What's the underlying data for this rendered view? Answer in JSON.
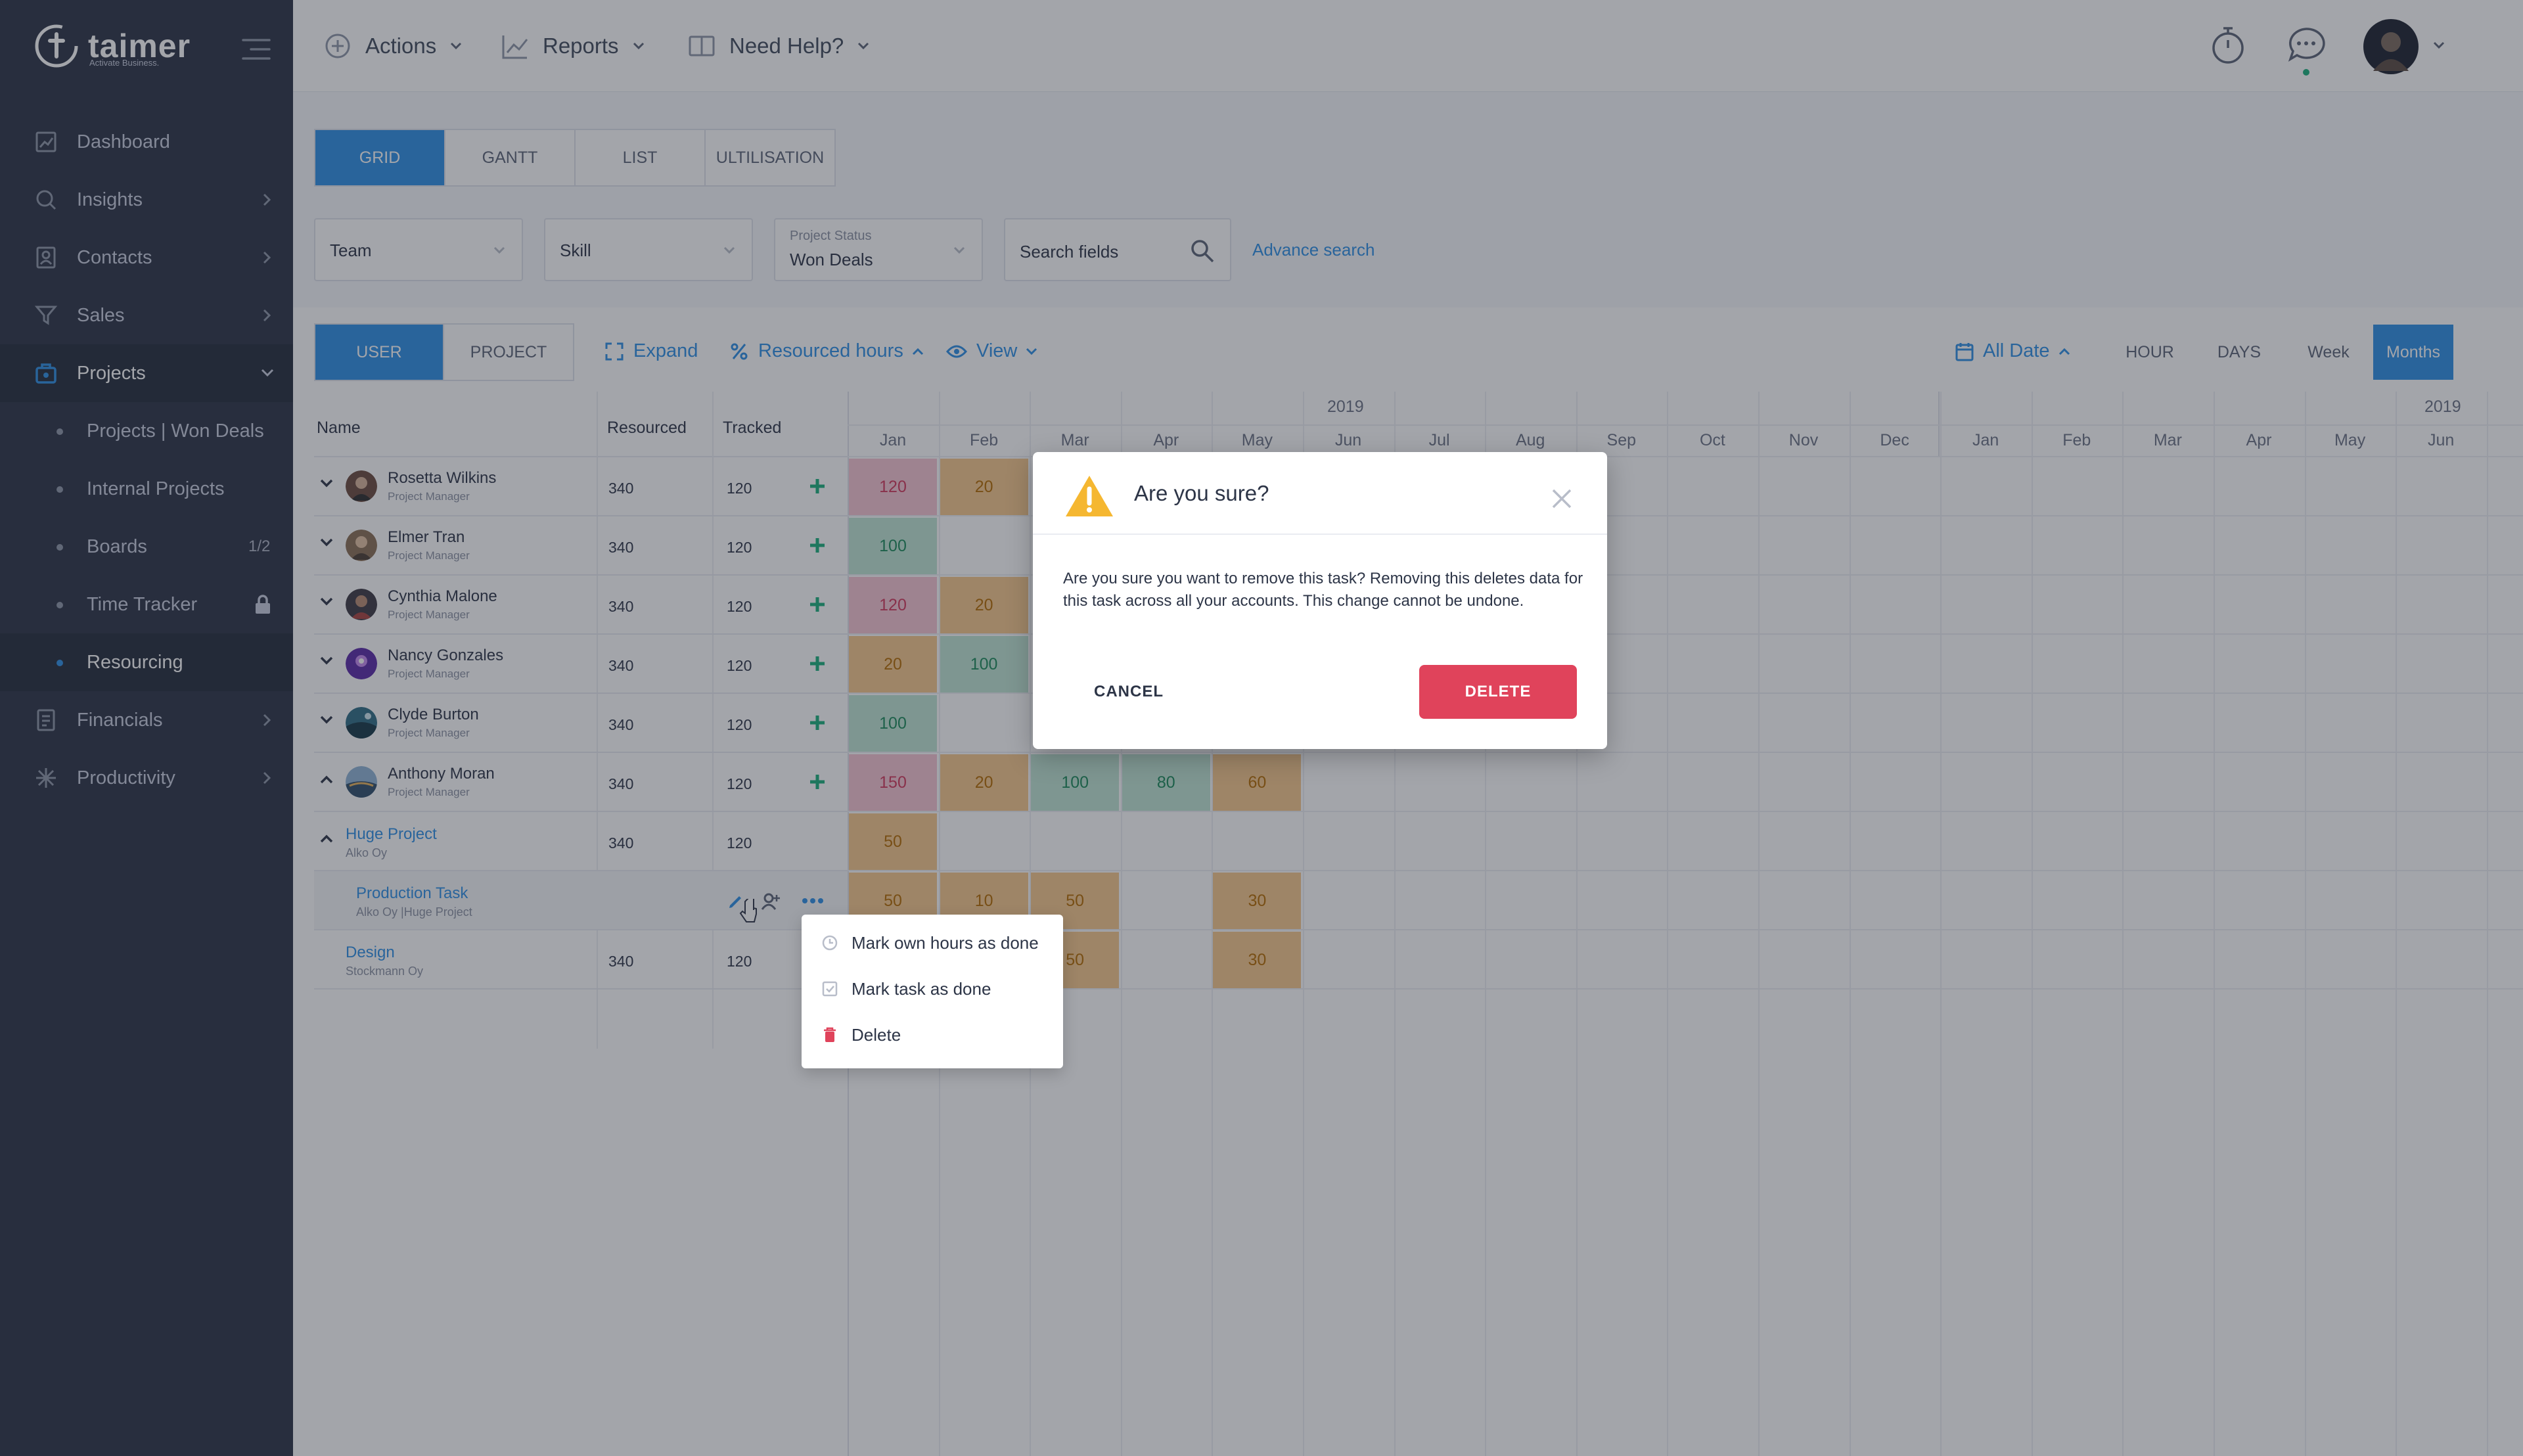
{
  "app": {
    "brand": "taimer",
    "tagline": "Activate Business."
  },
  "sidebar": {
    "items": [
      {
        "label": "Dashboard",
        "icon": "dashboard-icon"
      },
      {
        "label": "Insights",
        "icon": "insights-icon"
      },
      {
        "label": "Contacts",
        "icon": "contacts-icon"
      },
      {
        "label": "Sales",
        "icon": "filter-icon"
      },
      {
        "label": "Projects",
        "icon": "briefcase-icon"
      },
      {
        "label": "Financials",
        "icon": "financials-icon"
      },
      {
        "label": "Productivity",
        "icon": "productivity-icon"
      }
    ],
    "sub_items": [
      {
        "label": "Projects | Won Deals"
      },
      {
        "label": "Internal Projects"
      },
      {
        "label": "Boards",
        "count": "1/2"
      },
      {
        "label": "Time Tracker",
        "locked": true
      },
      {
        "label": "Resourcing"
      }
    ]
  },
  "header": {
    "actions": "Actions",
    "reports": "Reports",
    "help": "Need Help?"
  },
  "view_tabs": [
    "GRID",
    "GANTT",
    "LIST",
    "ULTILISATION"
  ],
  "filters": {
    "team": "Team",
    "skill": "Skill",
    "project_status_label": "Project Status",
    "project_status_value": "Won Deals",
    "search_placeholder": "Search fields",
    "advance_search": "Advance search"
  },
  "toolbar": {
    "user_tab": "USER",
    "project_tab": "PROJECT",
    "expand": "Expand",
    "resourced_hours": "Resourced hours",
    "view": "View",
    "all_date": "All Date",
    "scales": [
      "HOUR",
      "DAYS",
      "Week",
      "Months"
    ]
  },
  "table": {
    "columns": [
      "Name",
      "Resourced",
      "Tracked"
    ],
    "year_label": "2019",
    "months": [
      "Jan",
      "Feb",
      "Mar",
      "Apr",
      "May",
      "Jun",
      "Jul",
      "Aug",
      "Sep",
      "Oct",
      "Nov",
      "Dec",
      "Jan",
      "Feb",
      "Mar",
      "Apr",
      "May",
      "Jun"
    ],
    "users": [
      {
        "name": "Rosetta Wilkins",
        "role": "Project Manager",
        "resourced": "340",
        "tracked": "120",
        "cells": [
          "120",
          "20"
        ]
      },
      {
        "name": "Elmer Tran",
        "role": "Project Manager",
        "resourced": "340",
        "tracked": "120",
        "cells": [
          "100"
        ]
      },
      {
        "name": "Cynthia Malone",
        "role": "Project Manager",
        "resourced": "340",
        "tracked": "120",
        "cells": [
          "120",
          "20"
        ]
      },
      {
        "name": "Nancy Gonzales",
        "role": "Project Manager",
        "resourced": "340",
        "tracked": "120",
        "cells": [
          "20",
          "100"
        ]
      },
      {
        "name": "Clyde Burton",
        "role": "Project Manager",
        "resourced": "340",
        "tracked": "120",
        "cells": [
          "100"
        ]
      },
      {
        "name": "Anthony Moran",
        "role": "Project Manager",
        "resourced": "340",
        "tracked": "120",
        "cells": [
          "150",
          "20",
          "100",
          "80",
          "60"
        ]
      }
    ],
    "project": {
      "name": "Huge Project",
      "org": "Alko Oy",
      "resourced": "340",
      "tracked": "120",
      "cell": "50"
    },
    "task": {
      "name": "Production Task",
      "org": "Alko Oy |Huge Project",
      "cells": [
        "50",
        "10",
        "50",
        "",
        "30"
      ]
    },
    "design": {
      "name": "Design",
      "org": "Stockmann Oy",
      "resourced": "340",
      "tracked": "120",
      "cells": [
        "50",
        "30"
      ]
    }
  },
  "context_menu": {
    "items": [
      "Mark own hours as done",
      "Mark task as done",
      "Delete"
    ]
  },
  "modal": {
    "title": "Are you sure?",
    "body": "Are you sure you want to remove this task? Removing this deletes data for this task across all your accounts. This change cannot be undone.",
    "cancel": "CANCEL",
    "delete": "DELETE"
  },
  "colors": {
    "accent": "#2d8fe6",
    "sidebar": "#2b3346",
    "danger": "#e0435b",
    "heat_pink": "#f6c4d2",
    "heat_orange": "#f7c98c",
    "heat_green": "#bfe6d4",
    "warning": "#f5b731"
  }
}
